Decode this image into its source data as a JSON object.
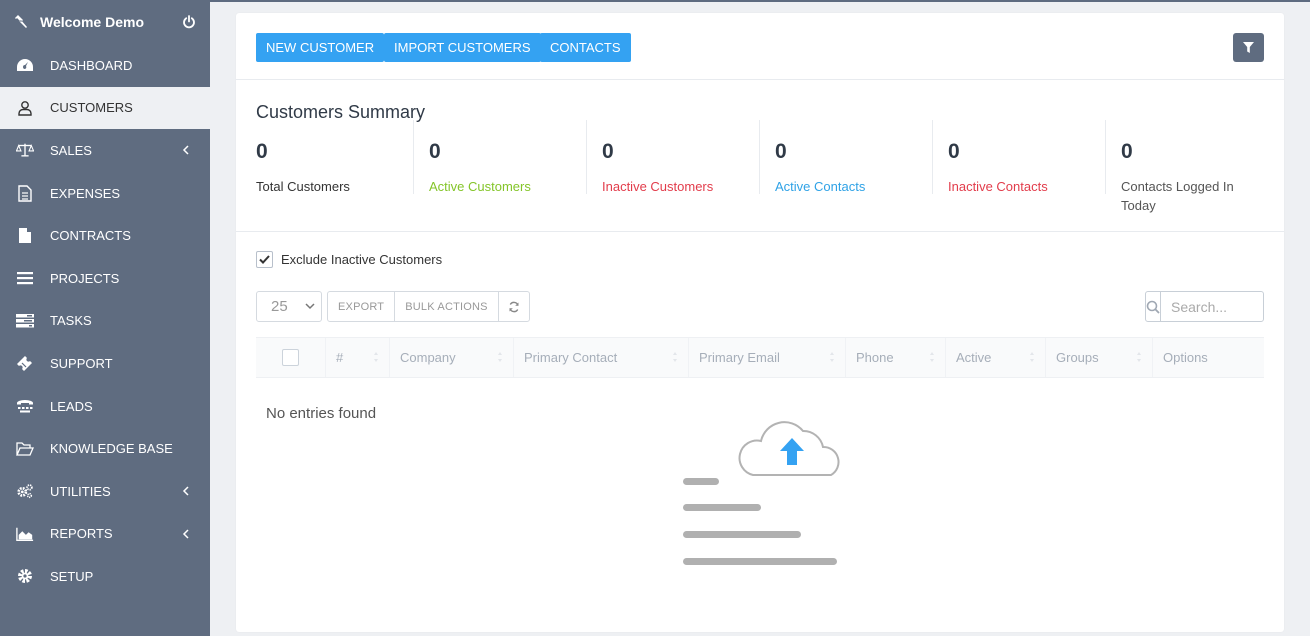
{
  "app": {
    "title": "Welcome Demo"
  },
  "sidebar": {
    "items": [
      {
        "label": "DASHBOARD",
        "icon": "dashboard-icon"
      },
      {
        "label": "CUSTOMERS",
        "icon": "user-icon"
      },
      {
        "label": "SALES",
        "icon": "balance-scale-icon"
      },
      {
        "label": "EXPENSES",
        "icon": "file-text-icon"
      },
      {
        "label": "CONTRACTS",
        "icon": "file-icon"
      },
      {
        "label": "PROJECTS",
        "icon": "bars-icon"
      },
      {
        "label": "TASKS",
        "icon": "tasks-icon"
      },
      {
        "label": "SUPPORT",
        "icon": "ticket-icon"
      },
      {
        "label": "LEADS",
        "icon": "tty-icon"
      },
      {
        "label": "KNOWLEDGE BASE",
        "icon": "folder-open-icon"
      },
      {
        "label": "UTILITIES",
        "icon": "cogs-icon"
      },
      {
        "label": "REPORTS",
        "icon": "area-chart-icon"
      },
      {
        "label": "SETUP",
        "icon": "cog-icon"
      }
    ]
  },
  "toolbar": {
    "new_customer": "NEW CUSTOMER",
    "import_customers": "IMPORT CUSTOMERS",
    "contacts": "CONTACTS"
  },
  "summary": {
    "title": "Customers Summary",
    "stats": [
      {
        "value": "0",
        "label": "Total Customers",
        "color": "#333333"
      },
      {
        "value": "0",
        "label": "Active Customers",
        "color": "#84c529"
      },
      {
        "value": "0",
        "label": "Inactive Customers",
        "color": "#e23c4b"
      },
      {
        "value": "0",
        "label": "Active Contacts",
        "color": "#2fa2e6"
      },
      {
        "value": "0",
        "label": "Inactive Contacts",
        "color": "#e23c4b"
      },
      {
        "value": "0",
        "label": "Contacts Logged In Today",
        "color": "#555555"
      }
    ]
  },
  "filters": {
    "exclude_inactive": "Exclude Inactive Customers"
  },
  "table": {
    "page_length": "25",
    "export": "EXPORT",
    "bulk_actions": "BULK ACTIONS",
    "search_placeholder": "Search...",
    "columns": [
      "#",
      "Company",
      "Primary Contact",
      "Primary Email",
      "Phone",
      "Active",
      "Groups",
      "Options"
    ],
    "empty": "No entries found"
  },
  "colors": {
    "accent": "#34a2f2",
    "sidebar": "#5f6c80"
  }
}
